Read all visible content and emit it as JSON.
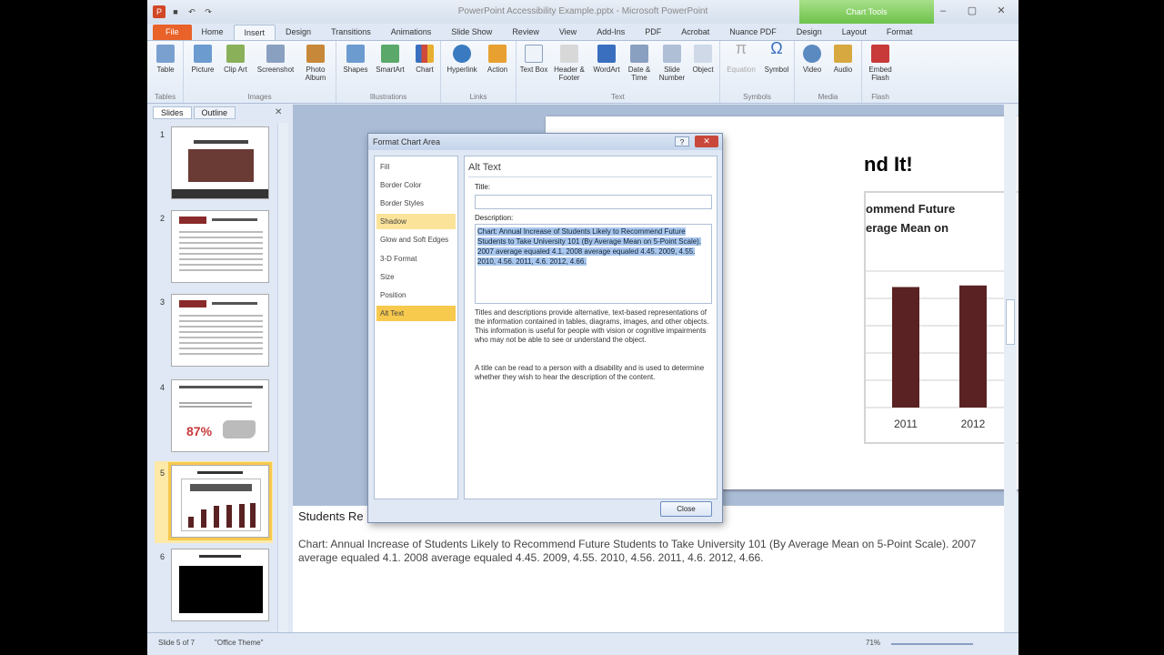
{
  "window": {
    "title": "PowerPoint Accessibility Example.pptx - Microsoft PowerPoint",
    "context_tools": "Chart Tools"
  },
  "ribbon_tabs": [
    "Home",
    "Insert",
    "Design",
    "Transitions",
    "Animations",
    "Slide Show",
    "Review",
    "View",
    "Add-Ins",
    "PDF",
    "Acrobat",
    "Nuance PDF",
    "Design",
    "Layout",
    "Format"
  ],
  "file_tab": "File",
  "ribbon_groups": [
    {
      "label": "Tables",
      "buttons": [
        "Table"
      ]
    },
    {
      "label": "Images",
      "buttons": [
        "Picture",
        "Clip Art",
        "Screenshot",
        "Photo Album"
      ]
    },
    {
      "label": "Illustrations",
      "buttons": [
        "Shapes",
        "SmartArt",
        "Chart"
      ]
    },
    {
      "label": "Links",
      "buttons": [
        "Hyperlink",
        "Action"
      ]
    },
    {
      "label": "Text",
      "buttons": [
        "Text Box",
        "Header & Footer",
        "WordArt",
        "Date & Time",
        "Slide Number",
        "Object"
      ]
    },
    {
      "label": "Symbols",
      "buttons": [
        "Equation",
        "Symbol"
      ]
    },
    {
      "label": "Media",
      "buttons": [
        "Video",
        "Audio"
      ]
    },
    {
      "label": "Flash",
      "buttons": [
        "Embed Flash"
      ]
    }
  ],
  "left_panel": {
    "tabs": [
      "Slides",
      "Outline"
    ],
    "slide_numbers": [
      "1",
      "2",
      "3",
      "4",
      "5",
      "6"
    ],
    "slide4_stat": "87%"
  },
  "slide": {
    "title_fragment": "nd It!",
    "chart_title_line1": "ommend Future",
    "chart_title_line2": "erage Mean on",
    "x_labels": [
      "2011",
      "2012"
    ],
    "bar_color": "#5a2222"
  },
  "chart_data": {
    "type": "bar",
    "categories": [
      "2011",
      "2012"
    ],
    "values": [
      4.6,
      4.66
    ]
  },
  "notes": {
    "title": "Students Re",
    "text": "Chart:  Annual Increase of Students Likely to Recommend Future Students to Take University 101 (By Average Mean on 5-Point Scale).  2007 average equaled 4.1.  2008 average equaled 4.45.  2009, 4.55.  2010, 4.56.  2011, 4.6.  2012, 4.66."
  },
  "dialog": {
    "title": "Format Chart Area",
    "help": "?",
    "close_x": "✕",
    "nav": [
      "Fill",
      "Border Color",
      "Border Styles",
      "Shadow",
      "Glow and Soft Edges",
      "3-D Format",
      "Size",
      "Position",
      "Alt Text"
    ],
    "heading": "Alt Text",
    "title_label": "Title:",
    "title_value": "",
    "desc_label": "Description:",
    "desc_value": "Chart: Annual Increase of Students Likely to Recommend Future Students to Take University 101 (By Average Mean on 5-Point Scale).  2007 average equaled 4.1.  2008 average equaled 4.45.  2009, 4.55.  2010, 4.56.  2011, 4.6.  2012, 4.66.",
    "help1": "Titles and descriptions provide alternative, text-based representations of the information contained in tables, diagrams, images, and other objects. This information is useful for people with vision or cognitive impairments who may not be able to see or understand the object.",
    "help2": "A title can be read to a person with a disability and is used to determine whether they wish to hear the description of the content.",
    "close_button": "Close"
  },
  "status": {
    "slide_info": "Slide 5 of 7",
    "theme": "\"Office Theme\"",
    "zoom": "71%"
  }
}
